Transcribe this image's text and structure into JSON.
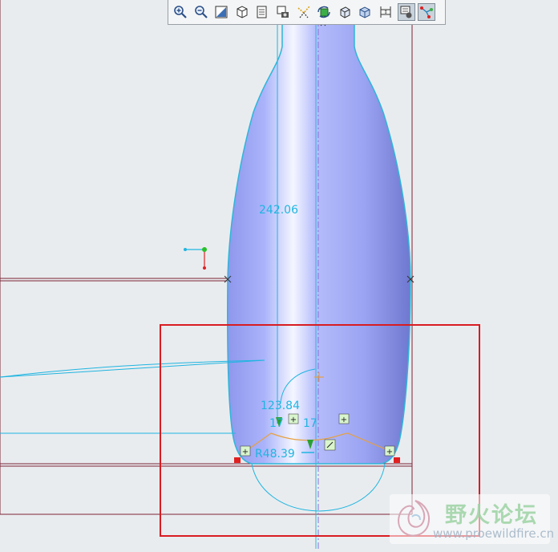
{
  "toolbar": {
    "buttons": [
      {
        "name": "zoom-in",
        "icon": "zoom-in-icon"
      },
      {
        "name": "zoom-out",
        "icon": "zoom-out-icon"
      },
      {
        "name": "refit",
        "icon": "refit-icon"
      },
      {
        "name": "display-style",
        "icon": "display-style-icon"
      },
      {
        "name": "saved-views",
        "icon": "saved-views-icon"
      },
      {
        "name": "layers",
        "icon": "layers-icon"
      },
      {
        "name": "datum-display",
        "icon": "datum-display-icon"
      },
      {
        "name": "spin-center",
        "icon": "spin-center-icon"
      },
      {
        "name": "orient-mode",
        "icon": "orient-mode-icon"
      },
      {
        "name": "view-manager",
        "icon": "view-manager-icon"
      },
      {
        "name": "sketch-view",
        "icon": "sketch-view-icon"
      },
      {
        "name": "sketch-display-filters",
        "icon": "sketch-display-filters-icon"
      },
      {
        "name": "dimension-display",
        "icon": "dimension-display-icon"
      }
    ]
  },
  "sketch": {
    "dimensions": {
      "height": "242.06",
      "angle": "123.84",
      "tangent_tag": "17",
      "tangent_tag2": "17",
      "radius_label": "R48.39"
    }
  },
  "colors": {
    "background": "#e9ecef",
    "bottle_fill": "#a7b0f8",
    "dimension": "#1fb5e0",
    "highlight_box": "#d81c22",
    "constraint_line": "#e8a040",
    "reference_line": "#7a2436"
  },
  "watermark": {
    "title": "野火论坛",
    "url": "www.proewildfire.cn"
  }
}
